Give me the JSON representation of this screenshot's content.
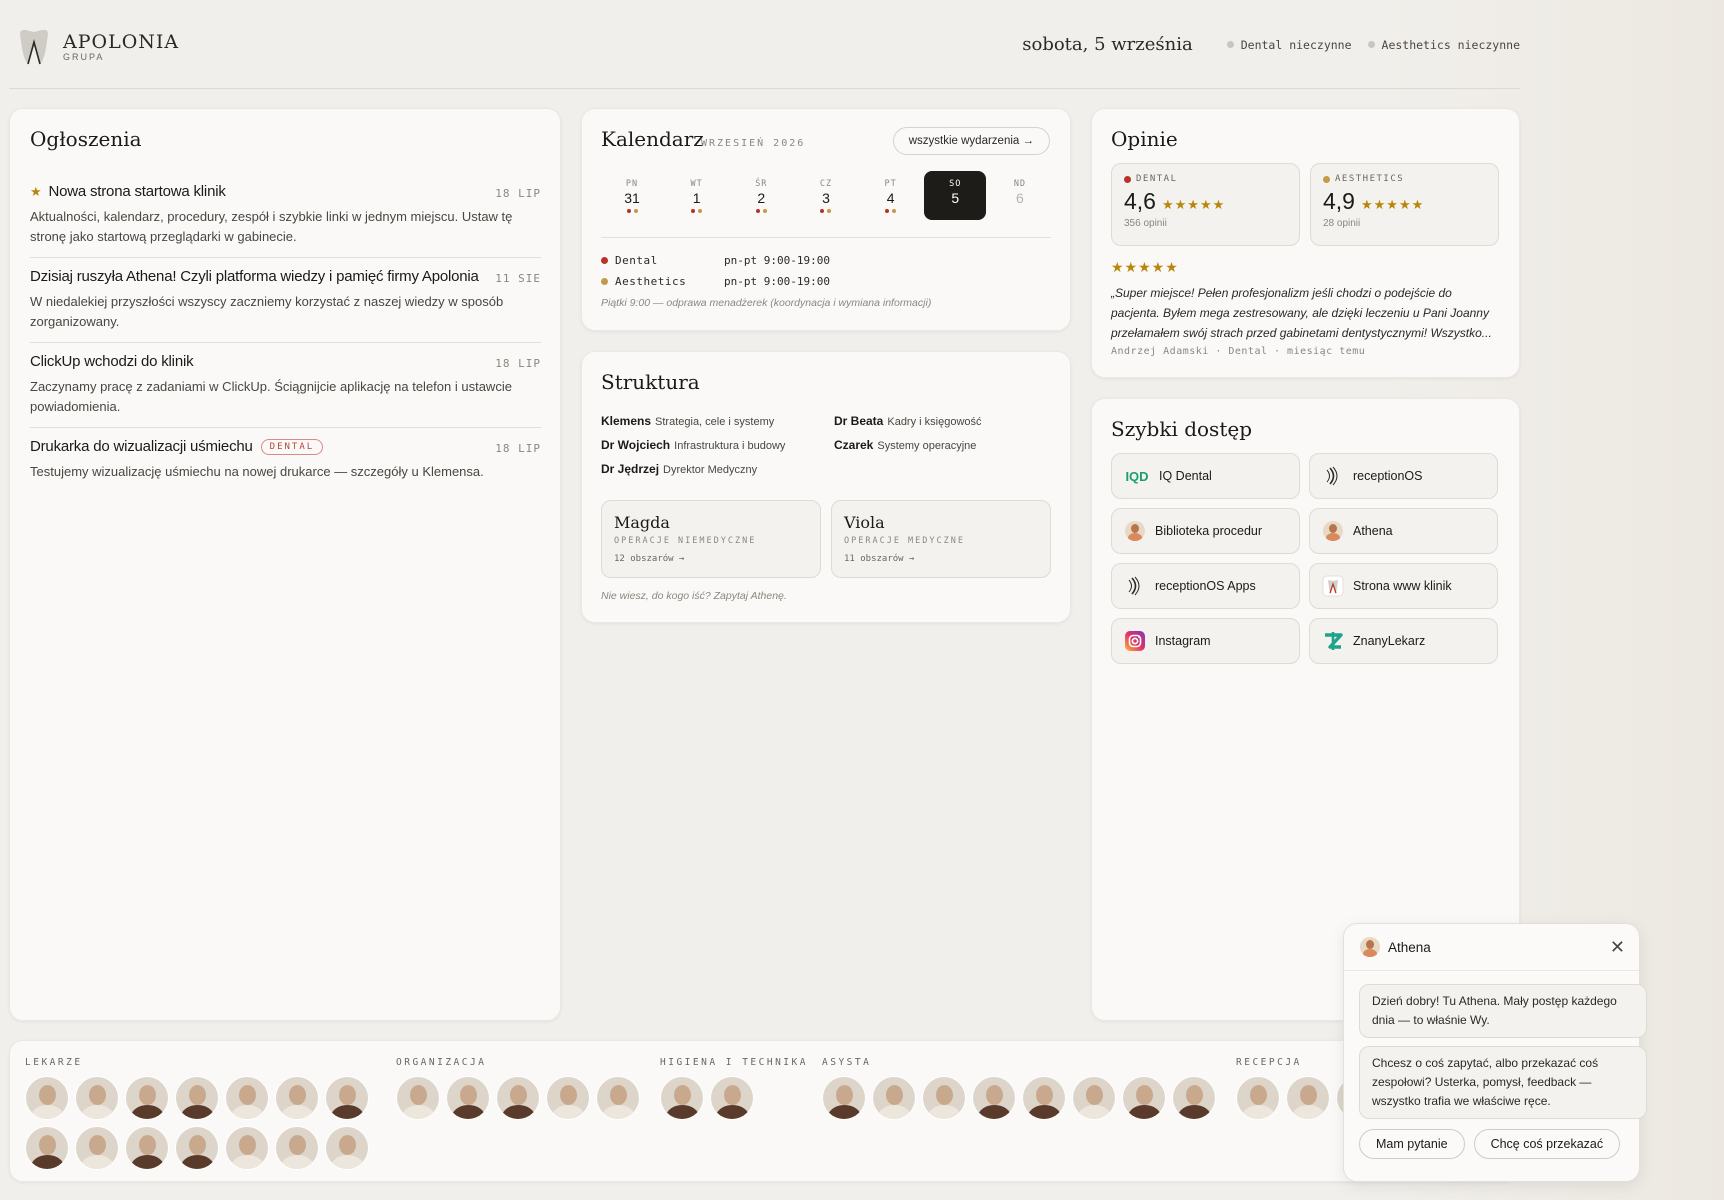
{
  "header": {
    "brand": "APOLONIA",
    "brand_sub": "GRUPA",
    "date": "sobota, 5 września",
    "status": [
      {
        "label": "Dental nieczynne",
        "color": "#c9c5bf"
      },
      {
        "label": "Aesthetics nieczynne",
        "color": "#c9c5bf"
      }
    ]
  },
  "announcements": {
    "title": "Ogłoszenia",
    "items": [
      {
        "title": "Nowa strona startowa klinik",
        "starred": true,
        "date": "18 LIP",
        "body": "Aktualności, kalendarz, procedury, zespół i szybkie linki w jednym miejscu. Ustaw tę stronę jako startową przeglądarki w gabinecie."
      },
      {
        "title": "Dzisiaj ruszyła Athena! Czyli platforma wiedzy i pamięć firmy Apolonia",
        "date": "11 SIE",
        "body": "W niedalekiej przyszłości wszyscy zaczniemy korzystać z naszej wiedzy w sposób zorganizowany."
      },
      {
        "title": "ClickUp wchodzi do klinik",
        "date": "18 LIP",
        "body": "Zaczynamy pracę z zadaniami w ClickUp. Ściągnijcie aplikację na telefon i ustawcie powiadomienia."
      },
      {
        "title": "Drukarka do wizualizacji uśmiechu",
        "tag": "DENTAL",
        "date": "18 LIP",
        "body": "Testujemy wizualizację uśmiechu na nowej drukarce — szczegóły u Klemensa."
      }
    ]
  },
  "calendar": {
    "title": "Kalendarz",
    "month": "WRZESIEŃ 2026",
    "all_events": "wszystkie wydarzenia →",
    "days": [
      {
        "name": "PN",
        "num": "31",
        "dots": true
      },
      {
        "name": "WT",
        "num": "1",
        "dots": true
      },
      {
        "name": "ŚR",
        "num": "2",
        "dots": true
      },
      {
        "name": "CZ",
        "num": "3",
        "dots": true
      },
      {
        "name": "PT",
        "num": "4",
        "dots": true
      },
      {
        "name": "SO",
        "num": "5",
        "today": true
      },
      {
        "name": "ND",
        "num": "6",
        "off": true
      }
    ],
    "hours": [
      {
        "name": "Dental",
        "hours": "pn-pt 9:00-19:00",
        "color": "#b8322a"
      },
      {
        "name": "Aesthetics",
        "hours": "pn-pt 9:00-19:00",
        "color": "#c39a4a"
      }
    ],
    "note": "Piątki 9:00 — odprawa menadżerek (koordynacja i wymiana informacji)"
  },
  "structure": {
    "title": "Struktura",
    "people": [
      {
        "name": "Klemens",
        "role": "Strategia, cele i systemy"
      },
      {
        "name": "Dr Beata",
        "role": "Kadry i księgowość"
      },
      {
        "name": "Dr Wojciech",
        "role": "Infrastruktura i budowy"
      },
      {
        "name": "Czarek",
        "role": "Systemy operacyjne"
      },
      {
        "name": "Dr Jędrzej",
        "role": "Dyrektor Medyczny"
      }
    ],
    "areas": [
      {
        "name": "Magda",
        "desc": "OPERACJE NIEMEDYCZNE",
        "count": "12 obszarów →"
      },
      {
        "name": "Viola",
        "desc": "OPERACJE MEDYCZNE",
        "count": "11 obszarów →"
      }
    ],
    "note": "Nie wiesz, do kogo iść? Zapytaj Athenę."
  },
  "reviews": {
    "title": "Opinie",
    "scores": [
      {
        "label": "DENTAL",
        "value": "4,6",
        "stars": "★★★★★",
        "count": "356 opinii",
        "color": "#b8322a"
      },
      {
        "label": "AESTHETICS",
        "value": "4,9",
        "stars": "★★★★★",
        "count": "28 opinii",
        "color": "#c39a4a"
      }
    ],
    "quote_stars": "★★★★★",
    "quote": "„Super miejsce! Pełen profesjonalizm jeśli chodzi o podejście do pacjenta. Byłem mega zestresowany, ale dzięki leczeniu u Pani Joanny przełamałem swój strach przed gabinetami dentystycznymi! Wszystko...",
    "author": "Andrzej Adamski · Dental · miesiąc temu"
  },
  "quick_access": {
    "title": "Szybki dostęp",
    "items": [
      {
        "label": "IQ Dental",
        "icon": "iq-dental-icon"
      },
      {
        "label": "receptionOS",
        "icon": "receptionos-icon"
      },
      {
        "label": "Biblioteka procedur",
        "icon": "athena-avatar-icon"
      },
      {
        "label": "Athena",
        "icon": "athena-avatar-icon"
      },
      {
        "label": "receptionOS Apps",
        "icon": "receptionos-icon"
      },
      {
        "label": "Strona www klinik",
        "icon": "apolonia-logo-icon"
      },
      {
        "label": "Instagram",
        "icon": "instagram-icon"
      },
      {
        "label": "ZnanyLekarz",
        "icon": "znanylekarz-icon"
      }
    ]
  },
  "team": {
    "groups": [
      {
        "title": "LEKARZE",
        "count": 14
      },
      {
        "title": "ORGANIZACJA",
        "count": 5
      },
      {
        "title": "HIGIENA I TECHNIKA",
        "count": 2
      },
      {
        "title": "ASYSTA",
        "count": 8
      },
      {
        "title": "RECEPCJA",
        "count": 3
      }
    ]
  },
  "chat": {
    "name": "Athena",
    "messages": [
      "Dzień dobry! Tu Athena. Mały postęp każdego dnia — to właśnie Wy.",
      "Chcesz o coś zapytać, albo przekazać coś zespołowi? Usterka, pomysł, feedback — wszystko trafia we właściwe ręce."
    ],
    "btn_question": "Mam pytanie",
    "btn_share": "Chcę coś przekazać"
  }
}
